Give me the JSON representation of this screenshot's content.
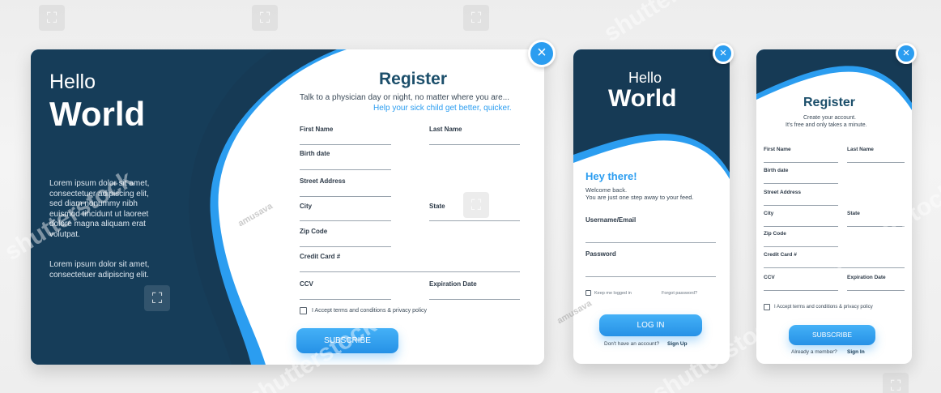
{
  "colors": {
    "navy": "#163a55",
    "blue": "#2b9df0",
    "title": "#1c4f6b",
    "link": "#2b9df0"
  },
  "close_icon": "×",
  "desktop": {
    "hello": "Hello",
    "world": "World",
    "lorem1": [
      "Lorem ipsum dolor sit amet,",
      "consectetuer adipiscing elit,",
      "sed diam nonummy nibh",
      "euismod tincidunt ut laoreet",
      "dolore magna aliquam erat",
      "volutpat."
    ],
    "lorem2": [
      "Lorem ipsum dolor sit amet,",
      "consectetuer adipiscing elit."
    ],
    "title": "Register",
    "subtitle": "Talk to a physician day or night, no matter where you are...",
    "subtitle_link": "Help your sick child get better, quicker.",
    "fields": {
      "first_name": "First Name",
      "last_name": "Last Name",
      "birth_date": "Birth date",
      "street_address": "Street Address",
      "city": "City",
      "state": "State",
      "zip_code": "Zip Code",
      "credit_card": "Credit Card #",
      "ccv": "CCV",
      "expiration_date": "Expiration Date"
    },
    "terms": "I Accept terms and conditions & privacy policy",
    "subscribe": "SUBSCRIBE"
  },
  "login": {
    "hello": "Hello",
    "world": "World",
    "greeting": "Hey there!",
    "welcome": "Welcome back.",
    "welcome2": "You are just one step away to your feed.",
    "username_label": "Username/Email",
    "password_label": "Password",
    "keep_logged": "Keep me logged in",
    "forgot": "Forgot password?",
    "login_btn": "LOG IN",
    "no_account": "Don't have an account?",
    "signup": "Sign Up"
  },
  "mobile_register": {
    "title": "Register",
    "subtitle1": "Create your account.",
    "subtitle2": "It's free and only takes a minute.",
    "fields": {
      "first_name": "First Name",
      "last_name": "Last Name",
      "birth_date": "Birth date",
      "street_address": "Street Address",
      "city": "City",
      "state": "State",
      "zip_code": "Zip Code",
      "credit_card": "Credit Card #",
      "ccv": "CCV",
      "expiration_date": "Expiration Date"
    },
    "terms": "I Accept terms and conditions & privacy policy",
    "subscribe": "SUBSCRIBE",
    "already": "Already a member?",
    "signin": "Sign In"
  },
  "watermark": {
    "brand": "shutterstock",
    "author": "amusava"
  }
}
